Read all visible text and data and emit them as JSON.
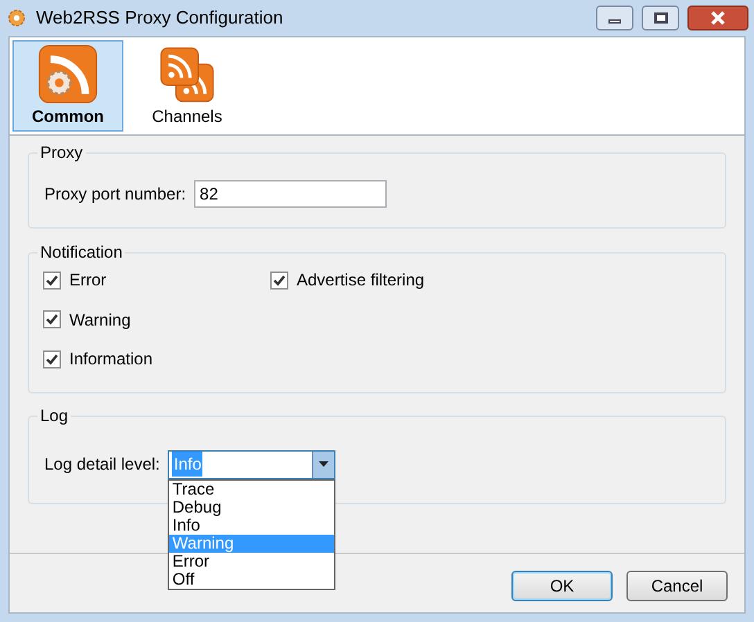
{
  "window": {
    "title": "Web2RSS Proxy Configuration"
  },
  "tabs": [
    {
      "label": "Common",
      "kind": "common",
      "selected": true
    },
    {
      "label": "Channels",
      "kind": "channels",
      "selected": false
    }
  ],
  "proxy": {
    "title": "Proxy",
    "port_label": "Proxy port number:",
    "port_value": "82"
  },
  "notification": {
    "title": "Notification",
    "checks": [
      {
        "label": "Error",
        "checked": true
      },
      {
        "label": "Warning",
        "checked": true
      },
      {
        "label": "Information",
        "checked": true
      },
      {
        "label": "Advertise filtering",
        "checked": true
      }
    ]
  },
  "log": {
    "title": "Log",
    "level_label": "Log detail level:",
    "level_value": "Info",
    "expanded": true,
    "options": [
      {
        "label": "Trace",
        "selected": false
      },
      {
        "label": "Debug",
        "selected": false
      },
      {
        "label": "Info",
        "selected": false
      },
      {
        "label": "Warning",
        "selected": true
      },
      {
        "label": "Error",
        "selected": false
      },
      {
        "label": "Off",
        "selected": false
      }
    ]
  },
  "buttons": [
    {
      "label": "OK",
      "default": true
    },
    {
      "label": "Cancel",
      "default": false
    }
  ]
}
